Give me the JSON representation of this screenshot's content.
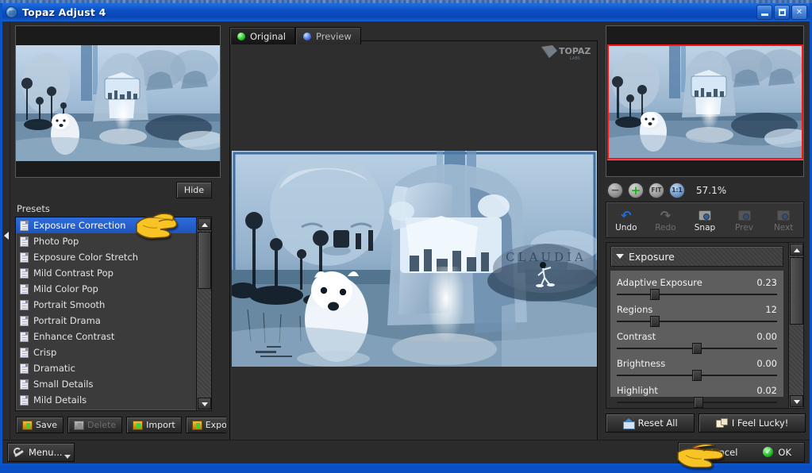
{
  "window": {
    "title": "Topaz Adjust 4",
    "icon": "globe-icon",
    "buttons": {
      "minimize": "minimize",
      "maximize": "maximize",
      "close": "close"
    }
  },
  "left_panel": {
    "hide_button": "Hide",
    "presets_label": "Presets",
    "presets": [
      {
        "label": "Exposure Correction",
        "selected": true
      },
      {
        "label": "Photo Pop",
        "selected": false
      },
      {
        "label": "Exposure Color Stretch",
        "selected": false
      },
      {
        "label": "Mild Contrast Pop",
        "selected": false
      },
      {
        "label": "Mild Color Pop",
        "selected": false
      },
      {
        "label": "Portrait Smooth",
        "selected": false
      },
      {
        "label": "Portrait Drama",
        "selected": false
      },
      {
        "label": "Enhance Contrast",
        "selected": false
      },
      {
        "label": "Crisp",
        "selected": false
      },
      {
        "label": "Dramatic",
        "selected": false
      },
      {
        "label": "Small Details",
        "selected": false
      },
      {
        "label": "Mild Details",
        "selected": false
      }
    ],
    "preset_buttons": [
      {
        "label": "Save",
        "icon": "box-add-icon",
        "enabled": true
      },
      {
        "label": "Delete",
        "icon": "box-delete-icon",
        "enabled": false
      },
      {
        "label": "Import",
        "icon": "box-import-icon",
        "enabled": true
      },
      {
        "label": "Export",
        "icon": "box-export-icon",
        "enabled": true
      }
    ]
  },
  "center_panel": {
    "tabs": [
      {
        "label": "Original",
        "dot": "green-dot-icon",
        "active": true
      },
      {
        "label": "Preview",
        "dot": "blue-dot-icon",
        "active": false
      }
    ],
    "logo": "topaz-labs-logo",
    "image_watermark": "CLAUDIA"
  },
  "right_panel": {
    "zoom_controls": [
      {
        "name": "zoom-out",
        "glyph": "−"
      },
      {
        "name": "zoom-in",
        "glyph": "+"
      },
      {
        "name": "fit",
        "glyph": "FIT"
      },
      {
        "name": "actual-size",
        "glyph": "1:1"
      }
    ],
    "zoom_percent": "57.1%",
    "tools": [
      {
        "label": "Undo",
        "icon": "undo-arrow-icon",
        "enabled": true
      },
      {
        "label": "Redo",
        "icon": "redo-arrow-icon",
        "enabled": false
      },
      {
        "label": "Snap",
        "icon": "camera-icon",
        "enabled": true
      },
      {
        "label": "Prev",
        "icon": "prev-snapshot-icon",
        "enabled": false
      },
      {
        "label": "Next",
        "icon": "next-snapshot-icon",
        "enabled": false
      }
    ],
    "group": {
      "title": "Exposure",
      "expanded": true,
      "sliders": [
        {
          "label": "Adaptive Exposure",
          "value": "0.23",
          "percent": 24
        },
        {
          "label": "Regions",
          "value": "12",
          "percent": 24
        },
        {
          "label": "Contrast",
          "value": "0.00",
          "percent": 50
        },
        {
          "label": "Brightness",
          "value": "0.00",
          "percent": 50
        },
        {
          "label": "Highlight",
          "value": "0.02",
          "percent": 51
        }
      ]
    },
    "reset_all": "Reset All",
    "i_feel_lucky": "I Feel Lucky!"
  },
  "bottom_bar": {
    "menu": "Menu...",
    "cancel": "Cancel",
    "ok": "OK"
  },
  "colors": {
    "titlebar_blue": "#0b50c4",
    "selection_blue": "#2d6ddb",
    "panel_bg": "#2c2c2c",
    "slider_panel": "#5e5e5e",
    "viewport_outline": "#ff1414",
    "accent_yellow": "#f5c518"
  }
}
